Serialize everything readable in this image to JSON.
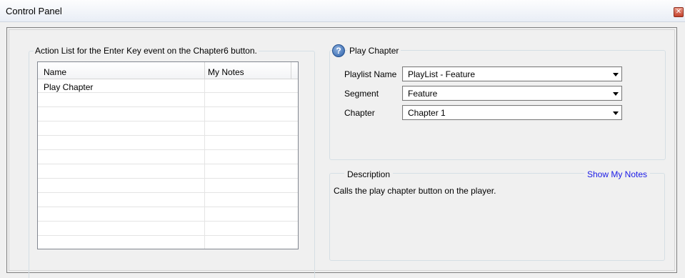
{
  "window": {
    "title": "Control Panel",
    "close_glyph": "✕"
  },
  "action_list": {
    "legend": "Action List for the Enter Key event on the Chapter6 button.",
    "columns": [
      "Name",
      "My Notes"
    ],
    "rows": [
      {
        "name": "Play Chapter",
        "notes": ""
      }
    ],
    "empty_row_count": 11
  },
  "play_chapter": {
    "icon": "help-icon",
    "icon_glyph": "?",
    "legend": "Play Chapter",
    "fields": [
      {
        "label": "Playlist Name",
        "value": "PlayList - Feature"
      },
      {
        "label": "Segment",
        "value": "Feature"
      },
      {
        "label": "Chapter",
        "value": "Chapter 1"
      }
    ]
  },
  "description": {
    "legend": "Description",
    "show_notes_link": "Show My Notes",
    "text": "Calls the play chapter button on the player."
  },
  "colors": {
    "link": "#1a1ae6",
    "close_button": "#c4422c"
  }
}
